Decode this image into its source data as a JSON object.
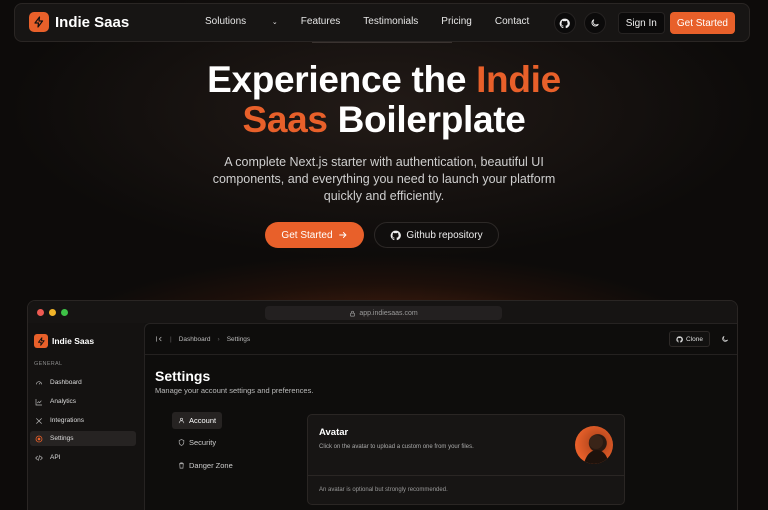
{
  "colors": {
    "accent": "#e8602a",
    "background": "#0d0b0a"
  },
  "nav": {
    "brand": "Indie Saas",
    "links": [
      "Solutions",
      "Features",
      "Testimonials",
      "Pricing",
      "Contact"
    ],
    "sign_in": "Sign In",
    "get_started": "Get Started",
    "icons": [
      "github-icon",
      "moon-icon"
    ]
  },
  "hero": {
    "title_part1": "Experience the",
    "title_accent1": "Indie",
    "title_accent2": "Saas",
    "title_part2": "Boilerplate",
    "subtitle": "A complete Next.js starter with authentication, beautiful UI components, and everything you need to launch your platform quickly and efficiently.",
    "cta_primary": "Get Started",
    "cta_secondary": "Github repository"
  },
  "app": {
    "url": "app.indiesaas.com",
    "brand": "Indie Saas",
    "section": "GENERAL",
    "sidebar_items": [
      {
        "label": "Dashboard",
        "icon": "gauge-icon"
      },
      {
        "label": "Analytics",
        "icon": "chart-icon"
      },
      {
        "label": "Integrations",
        "icon": "cross-icon"
      },
      {
        "label": "Settings",
        "icon": "settings-icon",
        "active": true
      },
      {
        "label": "API",
        "icon": "code-icon"
      }
    ],
    "breadcrumb": [
      "Dashboard",
      "Settings"
    ],
    "clone": "Clone",
    "settings_title": "Settings",
    "settings_sub": "Manage your account settings and preferences.",
    "tabs": [
      {
        "label": "Account",
        "icon": "user-icon",
        "active": true
      },
      {
        "label": "Security",
        "icon": "shield-icon"
      },
      {
        "label": "Danger Zone",
        "icon": "trash-icon"
      }
    ],
    "avatar_card": {
      "title": "Avatar",
      "description": "Click on the avatar to upload a custom one from your files.",
      "footer": "An avatar is optional but strongly recommended."
    }
  }
}
